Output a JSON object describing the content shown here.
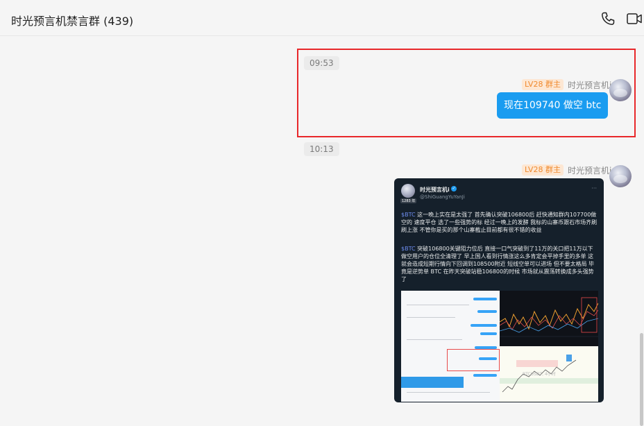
{
  "header": {
    "title": "时光预言机禁言群 (439)",
    "icons": [
      "phone-icon",
      "video-call-icon"
    ]
  },
  "messages": [
    {
      "time": "09:53",
      "sender_badge": "LV28 群主",
      "sender_name": "时光预言机i",
      "text": "现在109740 做空 btc"
    },
    {
      "time": "10:13",
      "sender_badge": "LV28 群主",
      "sender_name": "时光预言机i",
      "image": {
        "author": "时光预言机i",
        "handle": "@ShiGuangYuYanJi",
        "avatar_badge": "1283 年",
        "more": "···",
        "para1_tag": "$BTC",
        "para1": " 这一晚上实在是太强了 首先确认突破106800后 赶快通知群内107700做空的 速度平仓 选了一些强势的标 经过一晚上的发酵 我标的山寨币跟石市场齐刷刷上涨 不管你是买的那个山寨截止目前都有很不错的收益",
        "para2_tag": "$BTC",
        "para2": " 突破106800关键阻力位后 直接一口气突破到了11万的关口把11万以下做空用户的仓位全清理了 早上国人看到行情涨这么多肯定会平掉手里的多单 这就会造成短期行情向下回调到108500附近 短线空单可以进场 但不要太格局 毕竟是逆势单 BTC 在昨天突破站稳106800的时候 市场就从震荡转换成多头强势了",
        "chart_label": "BTCUSDT, 4小时"
      }
    }
  ]
}
